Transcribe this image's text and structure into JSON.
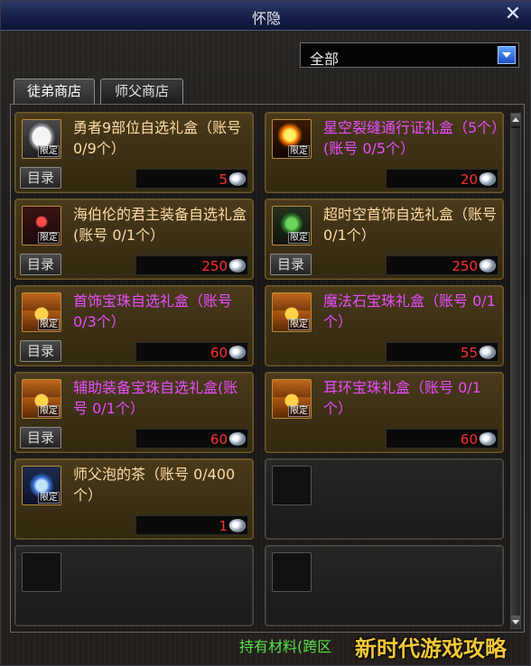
{
  "window": {
    "title": "怀隐"
  },
  "filter": {
    "selected": "全部"
  },
  "tabs": [
    {
      "label": "徒弟商店",
      "active": true
    },
    {
      "label": "师父商店",
      "active": false
    }
  ],
  "items": [
    {
      "name": "勇者9部位自选礼盒（账号 0/9个）",
      "name_color": "#ffdca4",
      "icon": "scroll-icon",
      "badge": "限定",
      "catalog": "目录",
      "price": "5"
    },
    {
      "name": "星空裂缝通行证礼盒（5个）(账号 0/5个）",
      "name_color": "#e94dff",
      "icon": "fire-icon",
      "badge": "限定",
      "catalog": "",
      "price": "20"
    },
    {
      "name": "海伯伦的君主装备自选礼盒(账号 0/1个）",
      "name_color": "#ffdca4",
      "icon": "red-gem-box-icon",
      "badge": "限定",
      "catalog": "目录",
      "price": "250"
    },
    {
      "name": "超时空首饰自选礼盒（账号 0/1个）",
      "name_color": "#ffdca4",
      "icon": "green-gem-box-icon",
      "badge": "限定",
      "catalog": "目录",
      "price": "250"
    },
    {
      "name": "首饰宝珠自选礼盒（账号 0/3个）",
      "name_color": "#e94dff",
      "icon": "chest-icon",
      "badge": "限定",
      "catalog": "目录",
      "price": "60"
    },
    {
      "name": "魔法石宝珠礼盒（账号 0/1个）",
      "name_color": "#e94dff",
      "icon": "chest-icon",
      "badge": "限定",
      "catalog": "",
      "price": "55"
    },
    {
      "name": "辅助装备宝珠自选礼盒(账号 0/1个）",
      "name_color": "#e94dff",
      "icon": "chest-icon",
      "badge": "限定",
      "catalog": "目录",
      "price": "60"
    },
    {
      "name": "耳环宝珠礼盒（账号 0/1个）",
      "name_color": "#e94dff",
      "icon": "chest-icon",
      "badge": "限定",
      "catalog": "",
      "price": "60"
    },
    {
      "name": "师父泡的茶（账号 0/400个）",
      "name_color": "#ffdca4",
      "icon": "tea-icon",
      "badge": "限定",
      "catalog": "",
      "price": "1"
    }
  ],
  "footer": {
    "label": "持有材料(跨区"
  },
  "watermark": {
    "text": "新时代游戏攻略"
  }
}
